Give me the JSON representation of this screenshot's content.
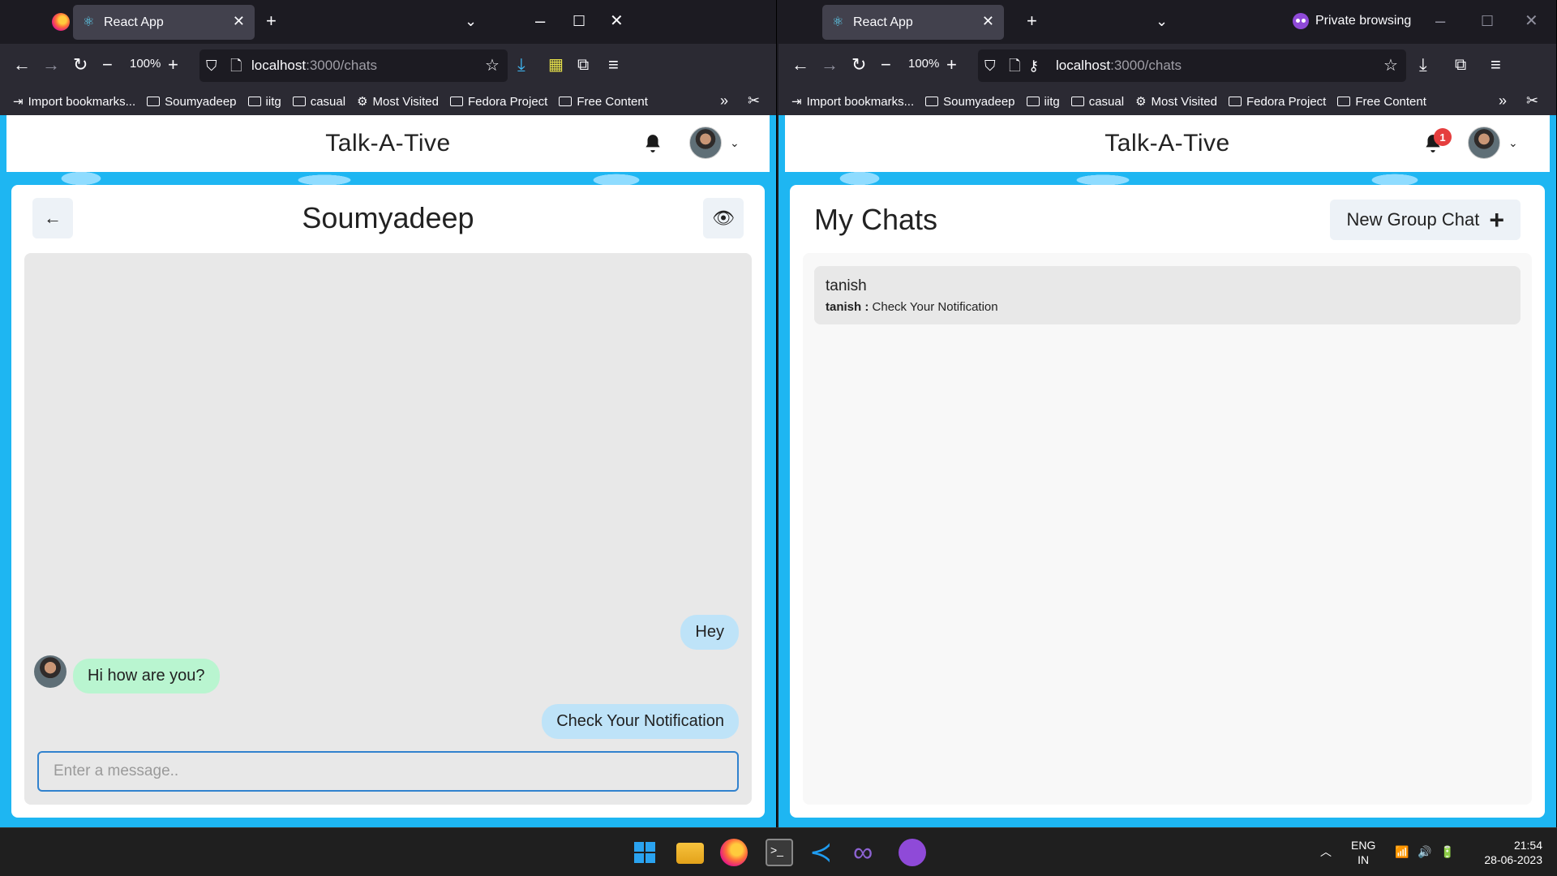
{
  "left_window": {
    "tab_title": "React App",
    "zoom": "100%",
    "url_host": "localhost",
    "url_path": ":3000/chats",
    "bookmarks": [
      "Import bookmarks...",
      "Soumyadeep",
      "iitg",
      "casual",
      "Most Visited",
      "Fedora Project",
      "Free Content"
    ],
    "app": {
      "title": "Talk-A-Tive",
      "chat_name": "Soumyadeep",
      "messages": [
        {
          "text": "Hey",
          "from": "me"
        },
        {
          "text": "Hi how are you?",
          "from": "them"
        },
        {
          "text": "Check Your Notification",
          "from": "me"
        }
      ],
      "input_placeholder": "Enter a message.."
    }
  },
  "right_window": {
    "tab_title": "React App",
    "private_label": "Private browsing",
    "zoom": "100%",
    "url_host": "localhost",
    "url_path": ":3000/chats",
    "bookmarks": [
      "Import bookmarks...",
      "Soumyadeep",
      "iitg",
      "casual",
      "Most Visited",
      "Fedora Project",
      "Free Content"
    ],
    "app": {
      "title": "Talk-A-Tive",
      "notification_count": "1",
      "my_chats_title": "My Chats",
      "new_group_label": "New Group Chat",
      "chats": [
        {
          "name": "tanish",
          "last_sender": "tanish :",
          "last_message": "Check Your Notification"
        }
      ]
    }
  },
  "taskbar": {
    "lang_line1": "ENG",
    "lang_line2": "IN",
    "time": "21:54",
    "date": "28-06-2023"
  },
  "colors": {
    "accent_blue": "#1eb6f2",
    "my_bubble": "#bee3f8",
    "their_bubble": "#b9f5d0",
    "badge_red": "#e53e3e"
  }
}
